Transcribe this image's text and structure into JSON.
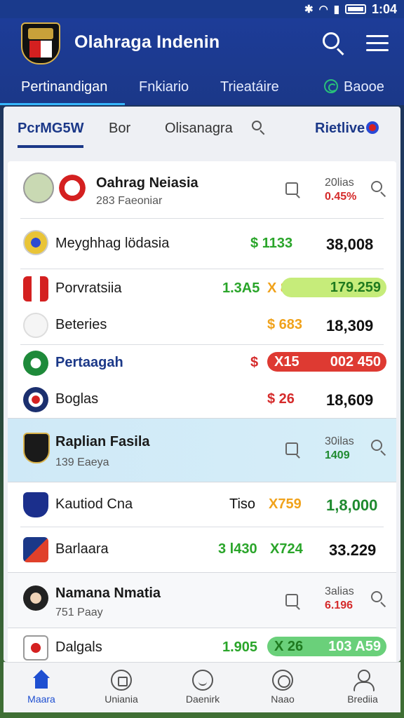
{
  "status": {
    "time": "1:04"
  },
  "header": {
    "title": "Olahraga Indenin",
    "tabs": [
      "Pertinandigan",
      "Fnkiario",
      "Trieatáire",
      "Baooe"
    ]
  },
  "subtabs": {
    "items": [
      "PcrMG5W",
      "Bor",
      "Olisanagra",
      "Rietlive"
    ]
  },
  "rows": [
    {
      "name": "Oahrag Neiasia",
      "sub": "283 Faeoniar",
      "small_top": "20lias",
      "small_val": "0.45%"
    },
    {
      "name": "Meyghhag lödasia",
      "odd1": "$ 1133",
      "value": "38,008"
    },
    {
      "name": "Porvratsiia",
      "odd1": "1.3A5",
      "odd2": "X 86",
      "value": "179.259"
    },
    {
      "name": "Beteries",
      "odd1": "$ 683",
      "value": "18,309"
    },
    {
      "name": "Pertaagah",
      "odd1": "$",
      "odd2": "X15",
      "value": "002 450"
    },
    {
      "name": "Boglas",
      "odd1": "$ 26",
      "value": "18,609"
    },
    {
      "name": "Raplian Fasila",
      "sub": "139 Eaeya",
      "small_top": "30ilas",
      "small_val": "1409"
    },
    {
      "name": "Kautiod Cna",
      "odd1": "Tiso",
      "odd2": "X759",
      "value": "1,8,000"
    },
    {
      "name": "Barlaara",
      "odd1": "3 l430",
      "odd2": "X724",
      "value": "33.229"
    },
    {
      "name": "Namana Nmatia",
      "sub": "751 Paay",
      "small_top": "3alias",
      "small_val": "6.196"
    },
    {
      "name": "Dalgals",
      "odd1": "1.905",
      "odd2": "X 26",
      "value": "103 A59"
    }
  ],
  "bottom_nav": [
    "Maara",
    "Uniania",
    "Daenirk",
    "Naao",
    "Brediia"
  ],
  "colors": {
    "header": "#1b3888",
    "accent": "#36b6ff",
    "green": "#2aa52a",
    "red": "#d52b2b",
    "orange": "#f0a21b"
  }
}
